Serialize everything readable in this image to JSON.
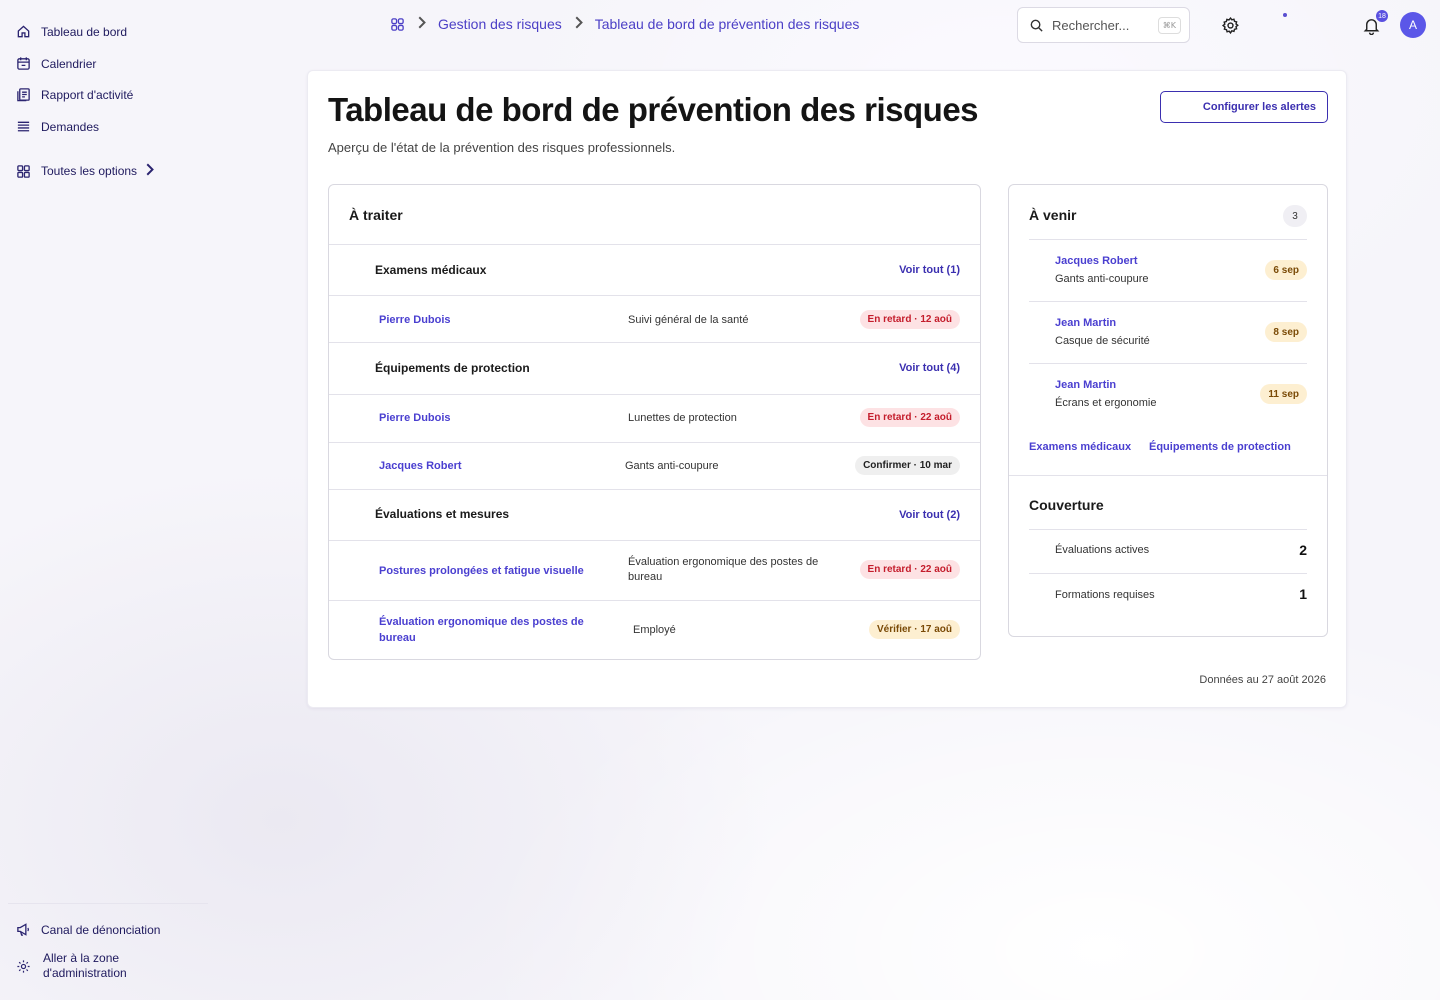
{
  "sidebar": {
    "items": [
      {
        "label": "Tableau de bord",
        "icon": "home-icon"
      },
      {
        "label": "Calendrier",
        "icon": "calendar-icon"
      },
      {
        "label": "Rapport d'activité",
        "icon": "report-icon"
      },
      {
        "label": "Demandes",
        "icon": "list-icon"
      }
    ],
    "all_options": "Toutes les options",
    "footer": {
      "whistleblowing": "Canal de dénonciation",
      "admin_line1": "Aller à la zone",
      "admin_line2": "d'administration"
    }
  },
  "breadcrumb": {
    "items": [
      "Gestion des risques",
      "Tableau de bord de prévention des risques"
    ]
  },
  "topbar": {
    "search_placeholder": "Rechercher...",
    "search_shortcut": "⌘K",
    "notification_count": "18",
    "avatar_initial": "A"
  },
  "page": {
    "title": "Tableau de bord de prévention des risques",
    "subtitle": "Aperçu de l'état de la prévention des risques professionnels.",
    "configure_alerts": "Configurer les alertes",
    "data_date": "Données au 27 août 2026"
  },
  "todo": {
    "title": "À traiter",
    "sections": [
      {
        "title": "Examens médicaux",
        "see_all": "Voir tout (1)",
        "rows": [
          {
            "name": "Pierre Dubois",
            "desc": "Suivi général de la santé",
            "badge": "En retard · 12 aoû",
            "status": "late"
          }
        ]
      },
      {
        "title": "Équipements de protection",
        "see_all": "Voir tout (4)",
        "rows": [
          {
            "name": "Pierre Dubois",
            "desc": "Lunettes de protection",
            "badge": "En retard · 22 aoû",
            "status": "late"
          },
          {
            "name": "Jacques Robert",
            "desc": "Gants anti-coupure",
            "badge": "Confirmer · 10 mar",
            "status": "confirm"
          }
        ]
      },
      {
        "title": "Évaluations et mesures",
        "see_all": "Voir tout (2)",
        "rows": [
          {
            "name": "Postures prolongées et fatigue visuelle",
            "desc": "Évaluation ergonomique des postes de bureau",
            "badge": "En retard · 22 aoû",
            "status": "late"
          },
          {
            "name": "Évaluation ergonomique des postes de bureau",
            "desc": "Employé",
            "badge": "Vérifier · 17 aoû",
            "status": "verify"
          }
        ]
      }
    ]
  },
  "upcoming": {
    "title": "À venir",
    "count": "3",
    "items": [
      {
        "name": "Jacques Robert",
        "item": "Gants anti-coupure",
        "date": "6 sep"
      },
      {
        "name": "Jean Martin",
        "item": "Casque de sécurité",
        "date": "8 sep"
      },
      {
        "name": "Jean Martin",
        "item": "Écrans et ergonomie",
        "date": "11 sep"
      }
    ],
    "links": [
      "Examens médicaux",
      "Équipements de protection"
    ]
  },
  "coverage": {
    "title": "Couverture",
    "rows": [
      {
        "label": "Évaluations actives",
        "value": "2"
      },
      {
        "label": "Formations requises",
        "value": "1"
      }
    ]
  },
  "colors": {
    "accent": "#4a3fd0",
    "late_bg": "#fde2e4",
    "late_fg": "#c41d2c",
    "warn_bg": "#fdefd1",
    "warn_fg": "#7a4a06"
  }
}
